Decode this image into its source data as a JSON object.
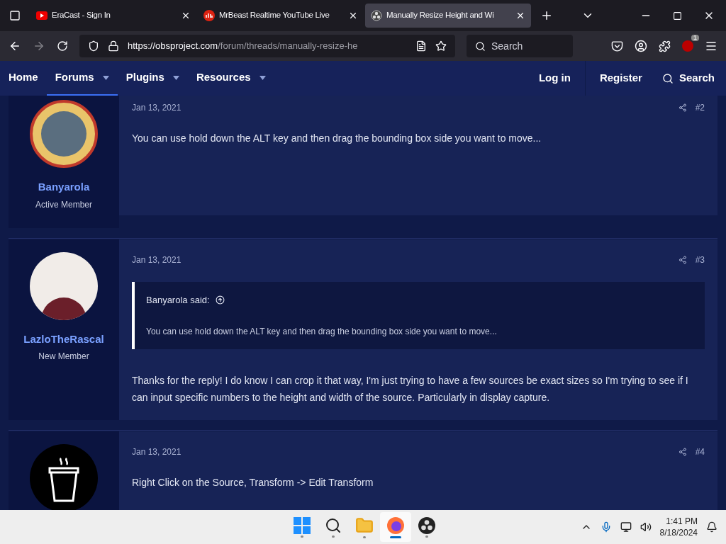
{
  "browser": {
    "tabs": [
      {
        "title": "EraCast - Sign In",
        "kind": "video",
        "selected": false
      },
      {
        "title": "MrBeast Realtime YouTube Live",
        "kind": "stats",
        "selected": false
      },
      {
        "title": "Manually Resize Height and Wi",
        "kind": "obs",
        "selected": true
      }
    ],
    "url_host": "https://obsproject.com",
    "url_path": "/forum/threads/manually-resize-he",
    "search_placeholder": "Search",
    "extension_badge": "1"
  },
  "nav": {
    "items": [
      {
        "label": "Home",
        "dropdown": false,
        "selected": false
      },
      {
        "label": "Forums",
        "dropdown": true,
        "selected": true
      },
      {
        "label": "Plugins",
        "dropdown": true,
        "selected": false
      },
      {
        "label": "Resources",
        "dropdown": true,
        "selected": false
      }
    ],
    "login": "Log in",
    "register": "Register",
    "search": "Search"
  },
  "posts": [
    {
      "user": "Banyarola",
      "role": "Active Member",
      "avatar": {
        "kind": "badge"
      },
      "date": "Jan 13, 2021",
      "number": "#2",
      "body": "You can use hold down the ALT key and then drag the bounding box side you want to move..."
    },
    {
      "user": "LazloTheRascal",
      "role": "New Member",
      "avatar": {
        "kind": "photo"
      },
      "date": "Jan 13, 2021",
      "number": "#3",
      "quote": {
        "author": "Banyarola said:",
        "text": "You can use hold down the ALT key and then drag the bounding box side you want to move..."
      },
      "body": "Thanks for the reply! I do know I can crop it that way, I'm just trying to have a few sources be exact sizes so I'm trying to see if I can input specific numbers to the height and width of the source. Particularly in display capture."
    },
    {
      "avatar": {
        "kind": "cup"
      },
      "date": "Jan 13, 2021",
      "number": "#4",
      "body": "Right Click on the Source, Transform -> Edit Transform"
    }
  ],
  "taskbar": {
    "apps": [
      {
        "kind": "start",
        "active": false
      },
      {
        "kind": "search",
        "active": false
      },
      {
        "kind": "folder",
        "active": false
      },
      {
        "kind": "browser",
        "active": true
      },
      {
        "kind": "obs",
        "active": false
      }
    ],
    "time": "1:41 PM",
    "date": "8/18/2024"
  }
}
